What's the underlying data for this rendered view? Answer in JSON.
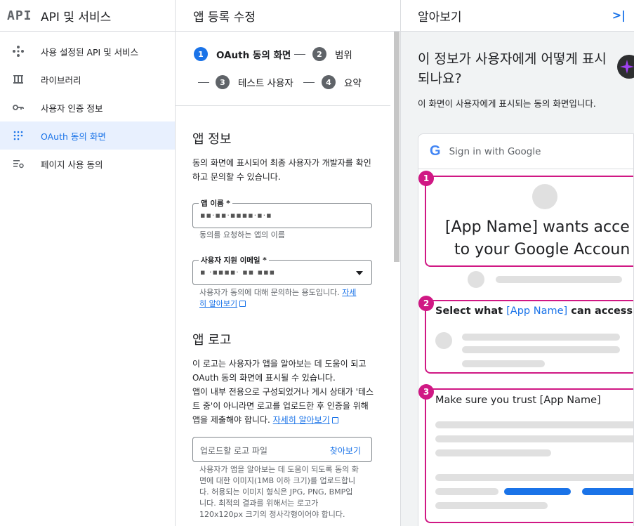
{
  "nav": {
    "logo": "API",
    "title": "API 및 서비스",
    "items": [
      {
        "label": "사용 설정된 API 및 서비스",
        "icon": "diamond-icon",
        "active": false
      },
      {
        "label": "라이브러리",
        "icon": "library-icon",
        "active": false
      },
      {
        "label": "사용자 인증 정보",
        "icon": "key-icon",
        "active": false
      },
      {
        "label": "OAuth 동의 화면",
        "icon": "oauth-icon",
        "active": true
      },
      {
        "label": "페이지 사용 동의",
        "icon": "settings-list-icon",
        "active": false
      }
    ]
  },
  "center": {
    "title": "앱 등록 수정",
    "steps": [
      {
        "num": "1",
        "label": "OAuth 동의 화면"
      },
      {
        "num": "2",
        "label": "범위"
      },
      {
        "num": "3",
        "label": "테스트 사용자"
      },
      {
        "num": "4",
        "label": "요약"
      }
    ],
    "app_info": {
      "heading": "앱 정보",
      "desc": "동의 화면에 표시되어 최종 사용자가 개발자를 확인하고 문의할 수 있습니다.",
      "app_name_label": "앱 이름 *",
      "app_name_value": "▪▪·▪▪·▪▪▪▪·▪·▪",
      "app_name_hint": "동의를 요청하는 앱의 이름",
      "email_label": "사용자 지원 이메일 *",
      "email_value": "▪ ·▪▪▪▪·   ▪▪ ▪▪▪",
      "email_hint": "사용자가 동의에 대해 문의하는 용도입니다.",
      "email_link": "자세히 알아보기"
    },
    "app_logo": {
      "heading": "앱 로고",
      "desc1": "이 로고는 사용자가 앱을 알아보는 데 도움이 되고 OAuth 동의 화면에 표시될 수 있습니다.",
      "desc2": "앱이 내부 전용으로 구성되었거나 게시 상태가 '테스트 중'이 아니라면 로고를 업로드한 후 인증을 위해 앱을 제출해야 합니다.",
      "link": "자세히 알아보기",
      "upload_placeholder": "업로드할 로고 파일",
      "browse": "찾아보기",
      "hint": "사용자가 앱을 알아보는 데 도움이 되도록 동의 화면에 대한 이미지(1MB 이하 크기)를 업로드합니다. 허용되는 이미지 형식은 JPG, PNG, BMP입니다. 최적의 결과를 위해서는 로고가 120x120px 크기의 정사각형이어야 합니다."
    }
  },
  "right": {
    "title": "알아보기",
    "collapse": ">|",
    "question": "이 정보가 사용자에게 어떻게 표시되나요?",
    "question_desc": "이 화면이 사용자에게 표시되는 동의 화면입니다.",
    "preview": {
      "google_g": "G",
      "sign_in": "Sign in with Google",
      "box1_num": "1",
      "box1_text1": "[App Name] wants acce",
      "box1_text2": "to your Google Accoun",
      "box2_num": "2",
      "box2_pre": "Select what ",
      "box2_app": "[App Name]",
      "box2_post": " can access",
      "box3_num": "3",
      "box3_text": "Make sure you trust [App Name]"
    }
  }
}
